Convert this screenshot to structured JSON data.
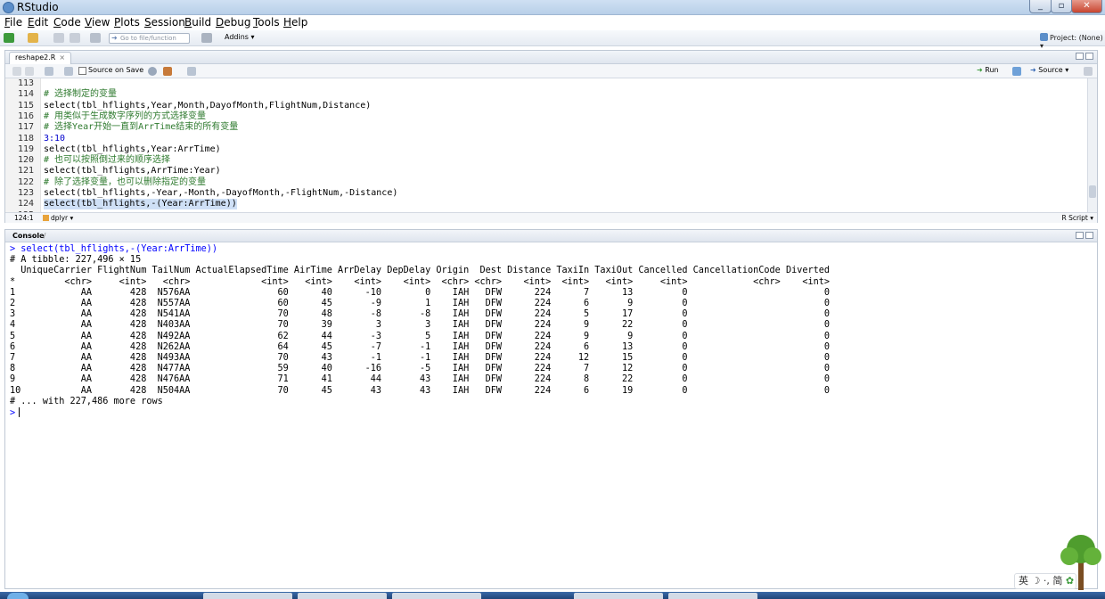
{
  "window": {
    "title": "RStudio"
  },
  "menu": [
    "File",
    "Edit",
    "Code",
    "View",
    "Plots",
    "Session",
    "Build",
    "Debug",
    "Tools",
    "Help"
  ],
  "toolbar": {
    "goto_placeholder": "Go to file/function",
    "addins_label": "Addins",
    "project_label": "Project: (None)"
  },
  "editor": {
    "file_tab": "reshape2.R",
    "source_on_save": "Source on Save",
    "run_label": "Run",
    "source_label": "Source",
    "lines": [
      {
        "n": "113",
        "text": "",
        "kind": "code"
      },
      {
        "n": "114",
        "text": "# 选择制定的变量",
        "kind": "comment"
      },
      {
        "n": "115",
        "text": "select(tbl_hflights,Year,Month,DayofMonth,FlightNum,Distance)",
        "kind": "code"
      },
      {
        "n": "116",
        "text": "# 用类似于生成数字序列的方式选择变量",
        "kind": "comment"
      },
      {
        "n": "117",
        "text": "# 选择Year开始一直到ArrTime结束的所有变量",
        "kind": "comment"
      },
      {
        "n": "118",
        "text": "3:10",
        "kind": "number"
      },
      {
        "n": "119",
        "text": "select(tbl_hflights,Year:ArrTime)",
        "kind": "code"
      },
      {
        "n": "120",
        "text": "# 也可以按照倒过来的顺序选择",
        "kind": "comment"
      },
      {
        "n": "121",
        "text": "select(tbl_hflights,ArrTime:Year)",
        "kind": "code"
      },
      {
        "n": "122",
        "text": "# 除了选择变量，也可以删除指定的变量",
        "kind": "comment"
      },
      {
        "n": "123",
        "text": "select(tbl_hflights,-Year,-Month,-DayofMonth,-FlightNum,-Distance)",
        "kind": "code"
      },
      {
        "n": "124",
        "text": "select(tbl_hflights,-(Year:ArrTime))",
        "kind": "selected"
      },
      {
        "n": "125",
        "text": "",
        "kind": "code"
      }
    ],
    "status_pos": "124:1",
    "status_scope": "dplyr",
    "status_type": "R Script"
  },
  "console": {
    "title": "Console",
    "wd": "~/",
    "lines": [
      "> select(tbl_hflights,-(Year:ArrTime))",
      "# A tibble: 227,496 × 15",
      "  UniqueCarrier FlightNum TailNum ActualElapsedTime AirTime ArrDelay DepDelay Origin  Dest Distance TaxiIn TaxiOut Cancelled CancellationCode Diverted",
      "*         <chr>     <int>   <chr>             <int>   <int>    <int>    <int>  <chr> <chr>    <int>  <int>   <int>     <int>            <chr>    <int>",
      "1            AA       428  N576AA                60      40      -10        0    IAH   DFW      224      7      13         0                         0",
      "2            AA       428  N557AA                60      45       -9        1    IAH   DFW      224      6       9         0                         0",
      "3            AA       428  N541AA                70      48       -8       -8    IAH   DFW      224      5      17         0                         0",
      "4            AA       428  N403AA                70      39        3        3    IAH   DFW      224      9      22         0                         0",
      "5            AA       428  N492AA                62      44       -3        5    IAH   DFW      224      9       9         0                         0",
      "6            AA       428  N262AA                64      45       -7       -1    IAH   DFW      224      6      13         0                         0",
      "7            AA       428  N493AA                70      43       -1       -1    IAH   DFW      224     12      15         0                         0",
      "8            AA       428  N477AA                59      40      -16       -5    IAH   DFW      224      7      12         0                         0",
      "9            AA       428  N476AA                71      41       44       43    IAH   DFW      224      8      22         0                         0",
      "10           AA       428  N504AA                70      45       43       43    IAH   DFW      224      6      19         0                         0",
      "# ... with 227,486 more rows"
    ],
    "prompt": ">"
  },
  "ime": {
    "label": "英",
    "mode": "简"
  }
}
